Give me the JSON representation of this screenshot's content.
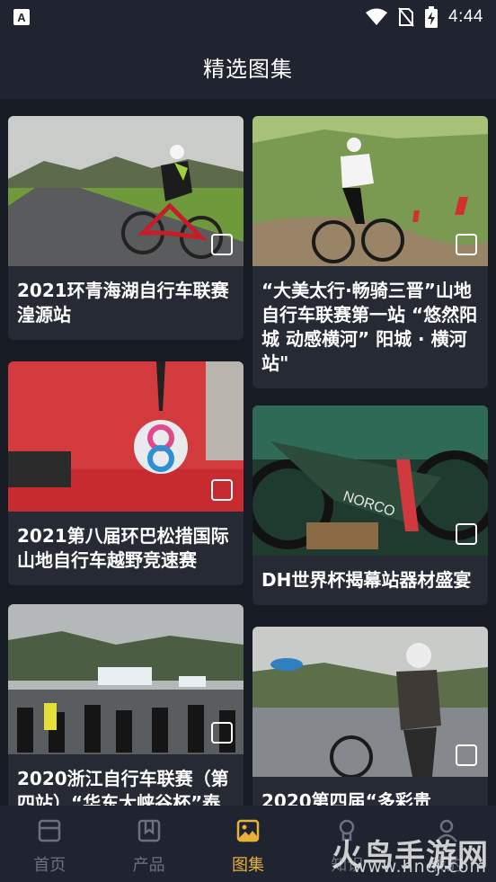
{
  "status_bar": {
    "time": "4:44",
    "icons": [
      "notification-a-icon",
      "wifi-icon",
      "no-sim-icon",
      "battery-charging-icon"
    ]
  },
  "app_bar": {
    "title": "精选图集"
  },
  "gallery": {
    "cards": [
      {
        "title": "2021环青海湖自行车联赛湟源站",
        "badge_icon": "gallery-icon"
      },
      {
        "title": "“大美太行·畅骑三晋”山地自行车联赛第一站 “悠然阳城 动感横河” 阳城 · 横河站\"",
        "badge_icon": "gallery-icon"
      },
      {
        "title": "2021第八届环巴松措国际山地自行车越野竞速赛",
        "badge_icon": "gallery-icon"
      },
      {
        "title": "DH世界杯揭幕站器材盛宴",
        "badge_icon": "gallery-icon"
      },
      {
        "title": "2020浙江自行车联赛（第四站）“华东大峡谷杯”泰",
        "badge_icon": "gallery-icon"
      },
      {
        "title": "2020第四届“多彩贵",
        "badge_icon": "gallery-icon"
      }
    ]
  },
  "tab_bar": {
    "tabs": [
      {
        "label": "首页",
        "icon": "home-icon",
        "active": false
      },
      {
        "label": "产品",
        "icon": "bookmark-icon",
        "active": false
      },
      {
        "label": "图集",
        "icon": "image-icon",
        "active": true
      },
      {
        "label": "知识",
        "icon": "knowledge-icon",
        "active": false
      },
      {
        "label": "我的",
        "icon": "profile-icon",
        "active": false
      }
    ]
  },
  "watermark": {
    "brand": "火鸟手游网",
    "url": "www.hncj.com"
  },
  "colors": {
    "accent": "#e8b23a",
    "background": "#161b24",
    "card": "#252a34",
    "bar": "#1f2430"
  }
}
